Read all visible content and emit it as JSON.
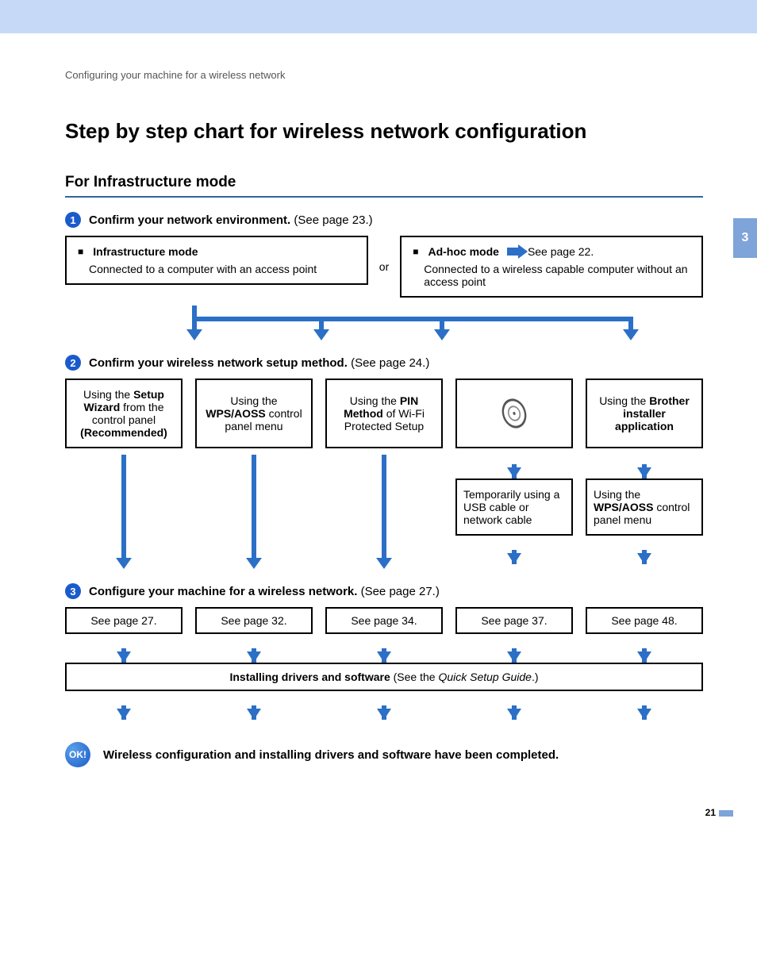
{
  "running_head": "Configuring your machine for a wireless network",
  "page_title": "Step by step chart for wireless network configuration",
  "section_title": "For Infrastructure mode",
  "chapter_tab": "3",
  "page_number": "21",
  "step1": {
    "num": "1",
    "bold": "Confirm your network environment.",
    "ref": " (See page 23.)"
  },
  "mode_infra": {
    "title": "Infrastructure mode",
    "desc": "Connected to a computer with an access point"
  },
  "or": "or",
  "mode_adhoc": {
    "title": "Ad-hoc mode",
    "ref": "See page 22.",
    "desc": "Connected to a wireless capable computer without an access point"
  },
  "step2": {
    "num": "2",
    "bold": "Confirm your wireless network setup method.",
    "ref": " (See page 24.)"
  },
  "methods": {
    "m1": {
      "p1": "Using the ",
      "b1": "Setup Wizard",
      "p2": " from the control panel ",
      "b2": "(Recommended)"
    },
    "m2": {
      "p1": "Using the ",
      "b1": "WPS/AOSS",
      "p2": " control panel menu"
    },
    "m3": {
      "p1": "Using the ",
      "b1": "PIN Method",
      "p2": " of Wi-Fi Protected Setup"
    },
    "m4": {
      "p1": "Using the ",
      "b1": "Brother installer application"
    }
  },
  "sub": {
    "s1": "Temporarily using a USB cable or network cable",
    "s2": {
      "p1": "Using the ",
      "b1": "WPS/AOSS",
      "p2": " control panel menu"
    }
  },
  "step3": {
    "num": "3",
    "bold": "Configure your machine for a wireless network.",
    "ref": " (See page 27.)"
  },
  "pages": {
    "p1": "See page 27.",
    "p2": "See page 32.",
    "p3": "See page 34.",
    "p4": "See page 37.",
    "p5": "See page 48."
  },
  "install": {
    "b": "Installing drivers and software",
    "rest": " (See the ",
    "it": "Quick Setup Guide",
    "tail": ".)"
  },
  "ok": "OK!",
  "done": "Wireless configuration and installing drivers and software have been completed."
}
